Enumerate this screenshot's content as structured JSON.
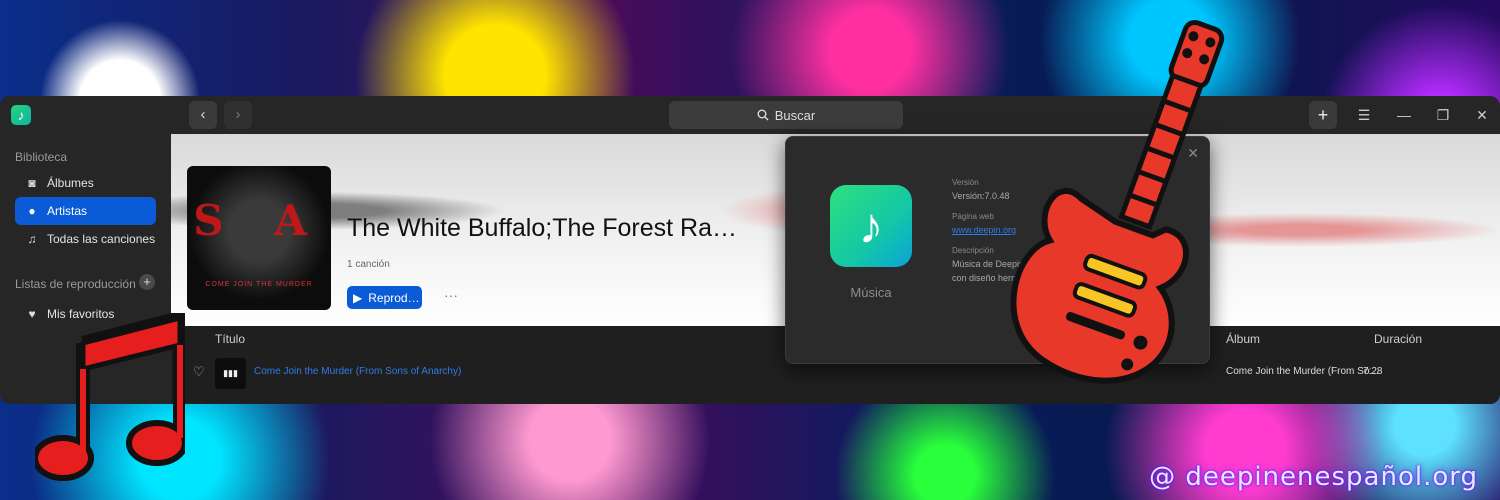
{
  "window": {
    "search_placeholder": "Buscar",
    "back_label": "‹",
    "forward_label": "›",
    "add_label": "+",
    "menu_label": "☰",
    "minimize_label": "—",
    "restore_label": "❐",
    "close_label": "✕"
  },
  "sidebar": {
    "library_heading": "Biblioteca",
    "items": [
      {
        "label": "Álbumes",
        "icon": "album-icon",
        "glyph": "◙"
      },
      {
        "label": "Artistas",
        "icon": "person-icon",
        "glyph": "👤"
      },
      {
        "label": "Todas las canciones",
        "icon": "note-icon",
        "glyph": "♫"
      }
    ],
    "playlists_heading": "Listas de reproducción",
    "playlists": [
      {
        "label": "Mis favoritos",
        "icon": "heart-icon",
        "glyph": "♥"
      }
    ]
  },
  "hero": {
    "cover_text": "S   A",
    "cover_subtext": "COME JOIN THE MURDER",
    "title": "The White Buffalo;The Forest Ra…",
    "count": "1 canción",
    "play_label": "Reprod…",
    "more_label": "···"
  },
  "table": {
    "columns": {
      "title": "Título",
      "album": "Álbum",
      "duration": "Duración"
    },
    "rows": [
      {
        "title": "Come Join the Murder (From Sons of Anarchy)",
        "album": "Come Join the Murder (From So…",
        "duration": "7:28"
      }
    ]
  },
  "about": {
    "app_name": "Música",
    "version_label": "Versión",
    "version_value": "Versión:7.0.48",
    "web_label": "Página web",
    "web_value": "www.deepin.org",
    "desc_label": "Descripción",
    "desc_line1": "Música de Deepin es un rep",
    "desc_line2": "con diseño hermoso y fu",
    "close_label": "✕"
  },
  "watermark": "@ deepinenespañol.org",
  "colors": {
    "accent": "#0b5bd6",
    "link": "#2f7be8",
    "window_bg": "#262626"
  }
}
